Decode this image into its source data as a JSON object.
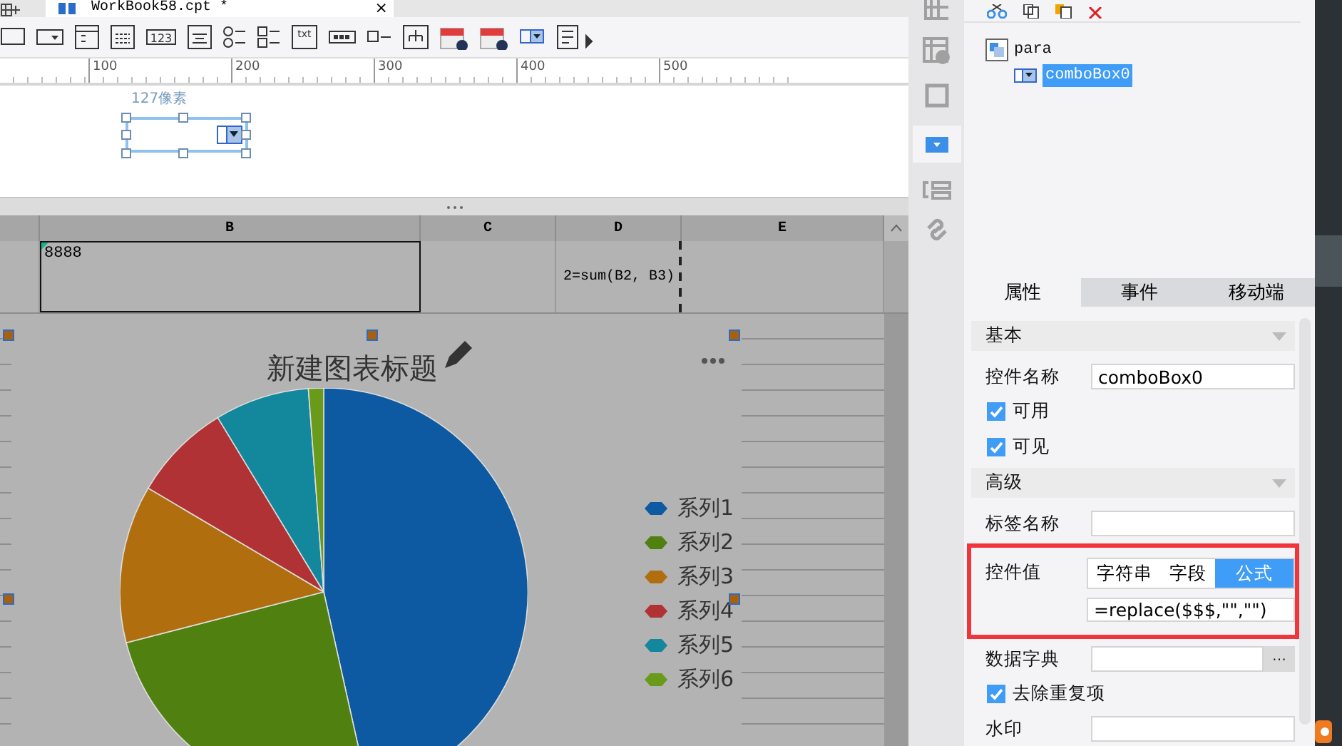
{
  "file_tab": {
    "title": "WorkBook58.cpt *",
    "close": "×"
  },
  "toolbar": {
    "number_icon_text": "123",
    "text_icon_text": "txt"
  },
  "ruler": {
    "ticks": [
      "100",
      "200",
      "300",
      "400",
      "500"
    ]
  },
  "widget": {
    "size_label": "127像素"
  },
  "sheet": {
    "columns": [
      {
        "label": "B",
        "cell": "8888"
      },
      {
        "label": "C"
      },
      {
        "label": "D",
        "cell": "2=sum(B2, B3)"
      },
      {
        "label": "E"
      }
    ]
  },
  "chart": {
    "title": "新建图表标题",
    "legend": [
      {
        "name": "系列1",
        "color": "#0d5aa3"
      },
      {
        "name": "系列2",
        "color": "#4f8010"
      },
      {
        "name": "系列3",
        "color": "#b06e0e"
      },
      {
        "name": "系列4",
        "color": "#b03234"
      },
      {
        "name": "系列5",
        "color": "#13879b"
      },
      {
        "name": "系列6",
        "color": "#6a9a1a"
      }
    ]
  },
  "tree": {
    "root": "para",
    "children": [
      {
        "label": "comboBox0",
        "selected": true
      }
    ]
  },
  "tabs": [
    {
      "label": "属性",
      "selected": true
    },
    {
      "label": "事件",
      "selected": false
    },
    {
      "label": "移动端",
      "selected": false
    }
  ],
  "properties": [
    {
      "kind": "section",
      "label": "基本"
    },
    {
      "kind": "field",
      "label": "控件名称",
      "value": "comboBox0"
    },
    {
      "kind": "checkbox",
      "label": "可用",
      "checked": true
    },
    {
      "kind": "checkbox",
      "label": "可见",
      "checked": true
    },
    {
      "kind": "section",
      "label": "高级"
    },
    {
      "kind": "field",
      "label": "标签名称"
    },
    {
      "kind": "segmented",
      "label": "控件值",
      "highlighted": true,
      "options": [
        {
          "label": "字符串",
          "selected": false
        },
        {
          "label": "字段",
          "selected": false
        },
        {
          "label": "公式",
          "selected": true
        }
      ],
      "value": "=replace($$$,\"\",\"\")"
    },
    {
      "kind": "dict",
      "label": "数据字典",
      "button": "···"
    },
    {
      "kind": "checkbox",
      "label": "去除重复项",
      "checked": true
    },
    {
      "kind": "field",
      "label": "水印"
    }
  ]
}
